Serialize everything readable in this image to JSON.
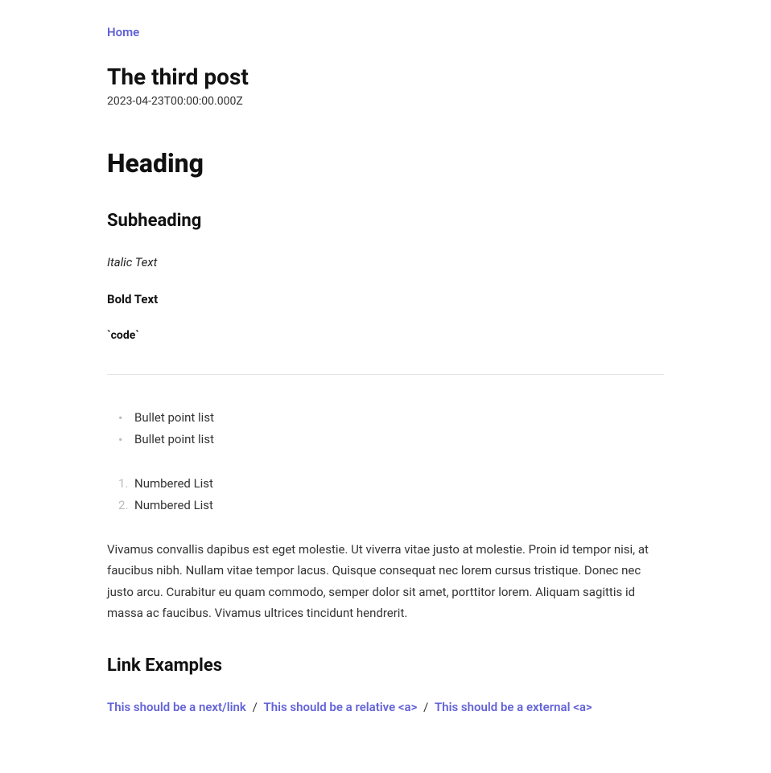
{
  "nav": {
    "home_label": "Home"
  },
  "post": {
    "title": "The third post",
    "date": "2023-04-23T00:00:00.000Z"
  },
  "content": {
    "heading": "Heading",
    "subheading": "Subheading",
    "italic_text": "Italic Text",
    "bold_text": "Bold Text",
    "code_text": "`code`",
    "bullet_items": [
      "Bullet point list",
      "Bullet point list"
    ],
    "numbered_items": [
      "Numbered List",
      "Numbered List"
    ],
    "paragraph": "Vivamus convallis dapibus est eget molestie. Ut viverra vitae justo at molestie. Proin id tempor nisi, at faucibus nibh. Nullam vitae tempor lacus. Quisque consequat nec lorem cursus tristique. Donec nec justo arcu. Curabitur eu quam commodo, semper dolor sit amet, porttitor lorem. Aliquam sagittis id massa ac faucibus. Vivamus ultrices tincidunt hendrerit.",
    "link_examples_heading": "Link Examples",
    "links": {
      "next_link": "This should be a next/link",
      "relative_a": "This should be a relative <a>",
      "external_a": "This should be a external <a>",
      "separator": " / "
    }
  }
}
